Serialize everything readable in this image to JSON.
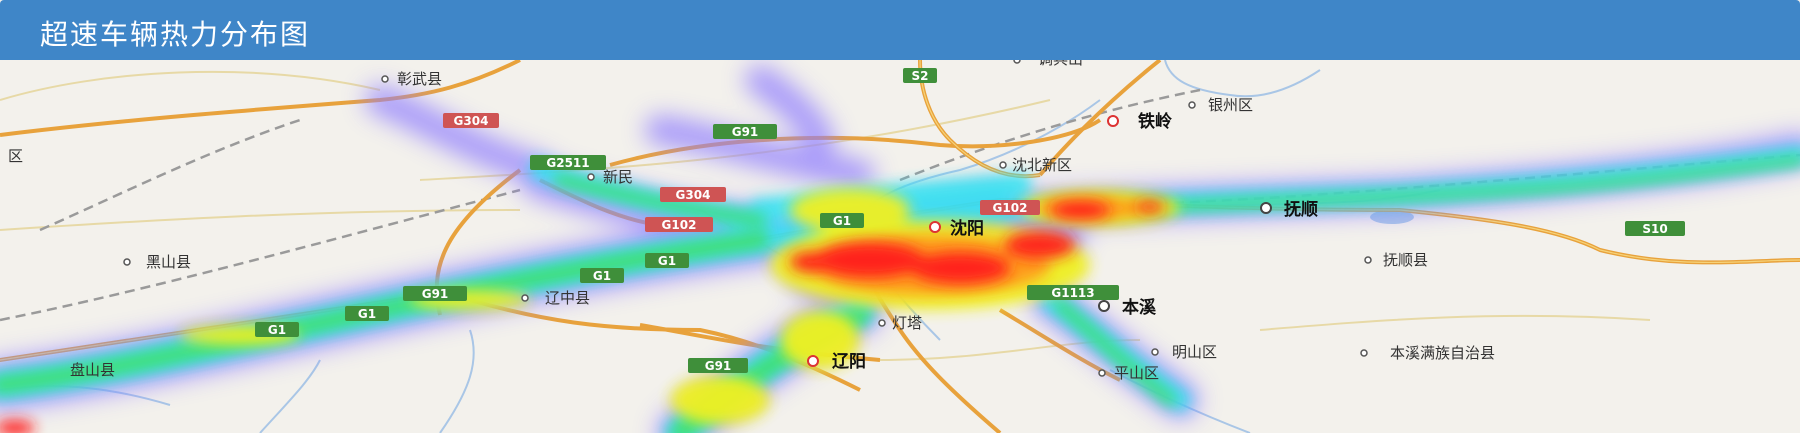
{
  "header": {
    "title": "超速车辆热力分布图"
  },
  "map": {
    "places": {
      "zhangwu": "彰武县",
      "tiaobingshan": "调兵山",
      "yinzhou": "银州区",
      "tieling": "铁岭",
      "shenbei": "沈北新区",
      "xinmin": "新民",
      "fushun": "抚顺",
      "fushun_county": "抚顺县",
      "heishan": "黑山县",
      "liaozhong": "辽中县",
      "shenyang": "沈阳",
      "benxi": "本溪",
      "dengta": "灯塔",
      "liaoyang": "辽阳",
      "mingshan": "明山区",
      "benxi_manchu": "本溪满族自治县",
      "pingshan": "平山区",
      "panshan": "盘山县",
      "edge_district": "区"
    },
    "roads": {
      "s2": "S2",
      "g304": "G304",
      "g91_north": "G91",
      "g2511": "G2511",
      "g304_b": "G304",
      "g102": "G102",
      "g1_a": "G1",
      "g1_b": "G1",
      "g1_c": "G1",
      "g1_d": "G1",
      "g1_e": "G1",
      "g91_south": "G91",
      "g1113": "G1113",
      "g102_b": "G102",
      "s10": "S10",
      "g91_c": "G91"
    }
  }
}
